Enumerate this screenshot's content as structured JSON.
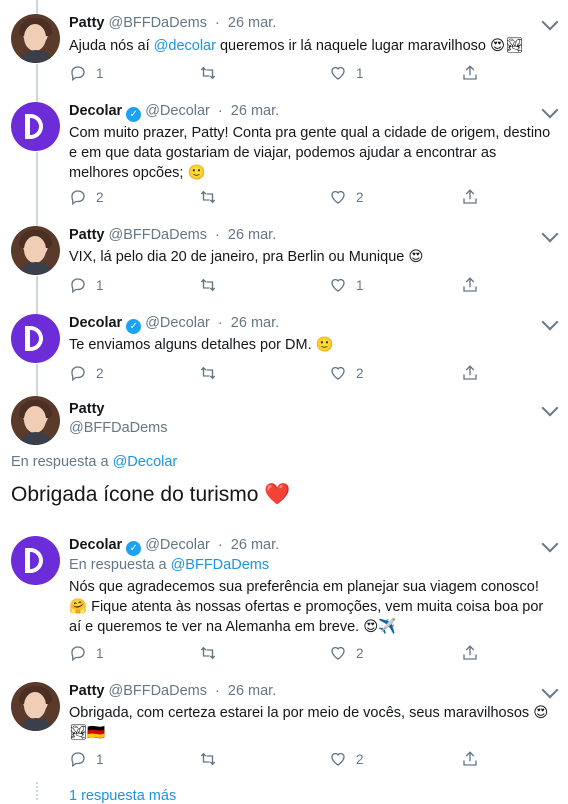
{
  "tweets": [
    {
      "name": "Patty",
      "handle": "@BFFDaDems",
      "date": "26 mar.",
      "text_pre": "Ajuda nós aí ",
      "mention": "@decolar",
      "text_post": " queremos ir lá naquele lugar maravilhoso 😍🏞",
      "replies": "1",
      "likes": "1"
    },
    {
      "name": "Decolar",
      "handle": "@Decolar",
      "date": "26 mar.",
      "text": "Com muito prazer, Patty! Conta pra gente qual a cidade de origem, destino e em que data gostariam de viajar, podemos ajudar a encontrar as melhores opcões; 🙂",
      "replies": "2",
      "likes": "2"
    },
    {
      "name": "Patty",
      "handle": "@BFFDaDems",
      "date": "26 mar.",
      "text": "VIX, lá pelo dia 20 de janeiro, pra Berlin ou Munique 😍",
      "replies": "1",
      "likes": "1"
    },
    {
      "name": "Decolar",
      "handle": "@Decolar",
      "date": "26 mar.",
      "text": "Te enviamos alguns detalhes por DM. 🙂",
      "replies": "2",
      "likes": "2"
    }
  ],
  "focused": {
    "name": "Patty",
    "handle": "@BFFDaDems",
    "reply_label": "En respuesta a",
    "reply_to": "@Decolar",
    "text": "Obrigada ícone do turismo ❤️"
  },
  "reply1": {
    "name": "Decolar",
    "handle": "@Decolar",
    "date": "26 mar.",
    "reply_label": "En respuesta a",
    "reply_to": "@BFFDaDems",
    "text": "Nós que agradecemos sua preferência em planejar sua viagem conosco! 🤗 Fique atenta às nossas ofertas e promoções, vem muita coisa boa por aí e queremos te ver na Alemanha em breve. 😍✈️",
    "replies": "1",
    "likes": "2"
  },
  "reply2": {
    "name": "Patty",
    "handle": "@BFFDaDems",
    "date": "26 mar.",
    "text": "Obrigada, com certeza estarei la por meio de vocês, seus maravilhosos 😍 🏞🇩🇪",
    "replies": "1",
    "likes": "2"
  },
  "more": "1 respuesta más",
  "colors": {
    "link": "#1b95e0",
    "muted": "#657786",
    "verified": "#1da1f2",
    "decolar": "#6c2dd8"
  }
}
